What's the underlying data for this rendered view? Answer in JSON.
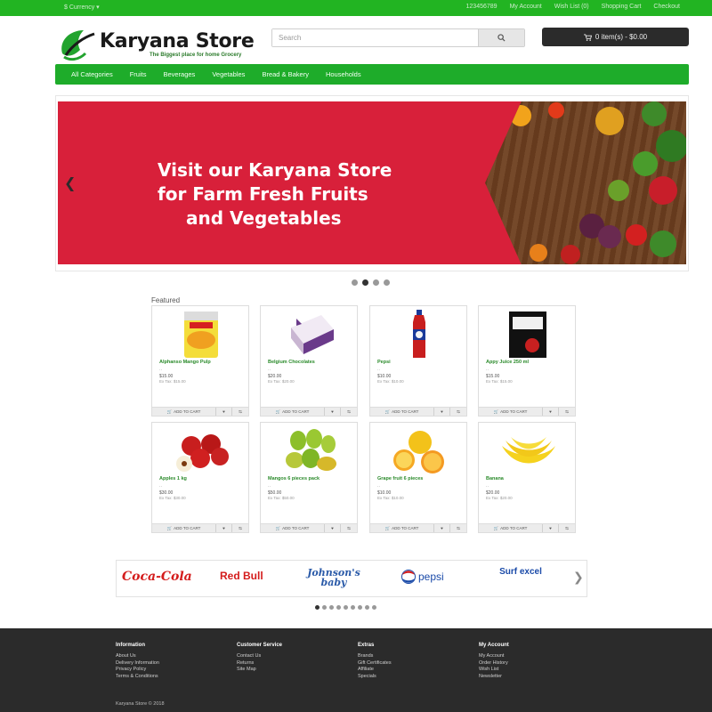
{
  "topbar": {
    "currency": "$ Currency ▾",
    "links": [
      "123456789",
      "My Account",
      "Wish List (0)",
      "Shopping Cart",
      "Checkout"
    ]
  },
  "header": {
    "logo_text": "Karyana Store",
    "tagline": "The Biggest place for home Grocery"
  },
  "search": {
    "placeholder": "Search"
  },
  "cart": {
    "label": "0 item(s) - $0.00"
  },
  "nav": {
    "items": [
      "All Categories",
      "Fruits",
      "Beverages",
      "Vegetables",
      "Bread & Bakery",
      "Households"
    ]
  },
  "banner": {
    "line1": "Visit our Karyana Store",
    "line2": "for Farm Fresh  Fruits",
    "line3": "and Vegetables"
  },
  "featured": {
    "label": "Featured",
    "add_to_cart": "ADD TO CART",
    "products": [
      {
        "name": "Alphanso Mango Pulp",
        "dash": "..",
        "price": "$15.00",
        "extax": "Ex Tax: $15.00"
      },
      {
        "name": "Belgium Chocolates",
        "dash": "..",
        "price": "$20.00",
        "extax": "Ex Tax: $20.00"
      },
      {
        "name": "Pepsi",
        "dash": "..",
        "price": "$10.00",
        "extax": "Ex Tax: $10.00"
      },
      {
        "name": "Appy Juice 250 ml",
        "dash": "..",
        "price": "$15.00",
        "extax": "Ex Tax: $15.00"
      },
      {
        "name": "Apples 1 kg",
        "dash": "..",
        "price": "$30.00",
        "extax": "Ex Tax: $30.00"
      },
      {
        "name": "Mangos 6 pieces pack",
        "dash": "..",
        "price": "$50.00",
        "extax": "Ex Tax: $50.00"
      },
      {
        "name": "Grape fruit 6 pieces",
        "dash": "..",
        "price": "$10.00",
        "extax": "Ex Tax: $10.00"
      },
      {
        "name": "Banana",
        "dash": "..",
        "price": "$20.00",
        "extax": "Ex Tax: $20.00"
      }
    ]
  },
  "brands": {
    "items": [
      "Coca-Cola",
      "Red Bull",
      "Johnson's baby",
      "pepsi",
      "Surf excel"
    ]
  },
  "footer": {
    "columns": [
      {
        "heading": "Information",
        "links": [
          "About Us",
          "Delivery Information",
          "Privacy Policy",
          "Terms & Conditions"
        ]
      },
      {
        "heading": "Customer Service",
        "links": [
          "Contact Us",
          "Returns",
          "Site Map"
        ]
      },
      {
        "heading": "Extras",
        "links": [
          "Brands",
          "Gift Certificates",
          "Affiliate",
          "Specials"
        ]
      },
      {
        "heading": "My Account",
        "links": [
          "My Account",
          "Order History",
          "Wish List",
          "Newsletter"
        ]
      }
    ],
    "copyright": "Karyana Store © 2018"
  },
  "colors": {
    "brand_green": "#1eac2a",
    "banner_red": "#d8203a",
    "footer_dark": "#2b2b2b"
  }
}
